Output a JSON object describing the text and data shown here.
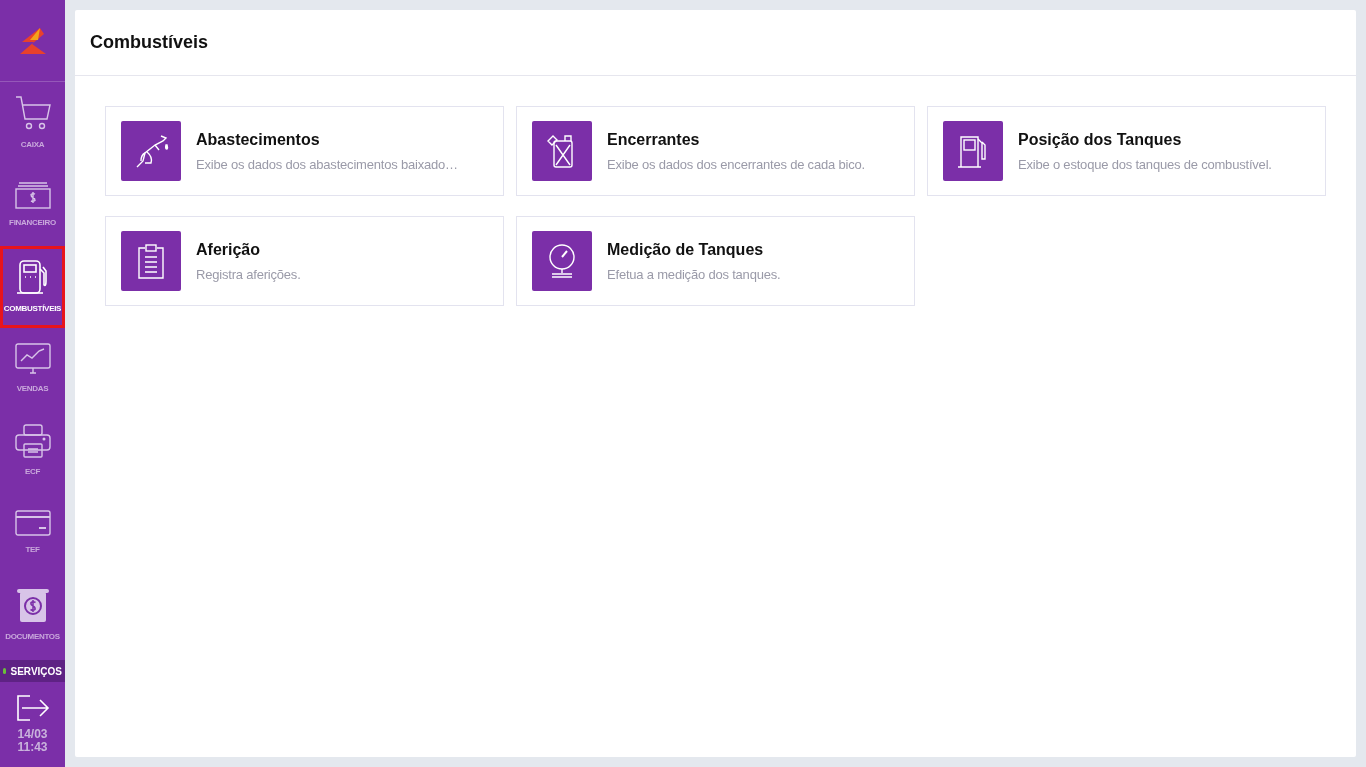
{
  "sidebar": {
    "items": [
      {
        "label": "CAIXA",
        "selected": false
      },
      {
        "label": "FINANCEIRO",
        "selected": false
      },
      {
        "label": "COMBUSTÍVEIS",
        "selected": true
      },
      {
        "label": "VENDAS",
        "selected": false
      },
      {
        "label": "ECF",
        "selected": false
      },
      {
        "label": "TEF",
        "selected": false
      },
      {
        "label": "DOCUMENTOS",
        "selected": false
      }
    ],
    "services": {
      "label": "SERVIÇOS",
      "color": "#6abf3a"
    },
    "date": "14/03",
    "time": "11:43"
  },
  "page": {
    "title": "Combustíveis",
    "cards": [
      {
        "title": "Abastecimentos",
        "description": "Exibe os dados dos abastecimentos baixado…"
      },
      {
        "title": "Encerrantes",
        "description": "Exibe os dados dos encerrantes de cada bico."
      },
      {
        "title": "Posição dos Tanques",
        "description": "Exibe o estoque dos tanques de combustível."
      },
      {
        "title": "Aferição",
        "description": "Registra aferições."
      },
      {
        "title": "Medição de Tanques",
        "description": "Efetua a medição dos tanques."
      }
    ]
  }
}
